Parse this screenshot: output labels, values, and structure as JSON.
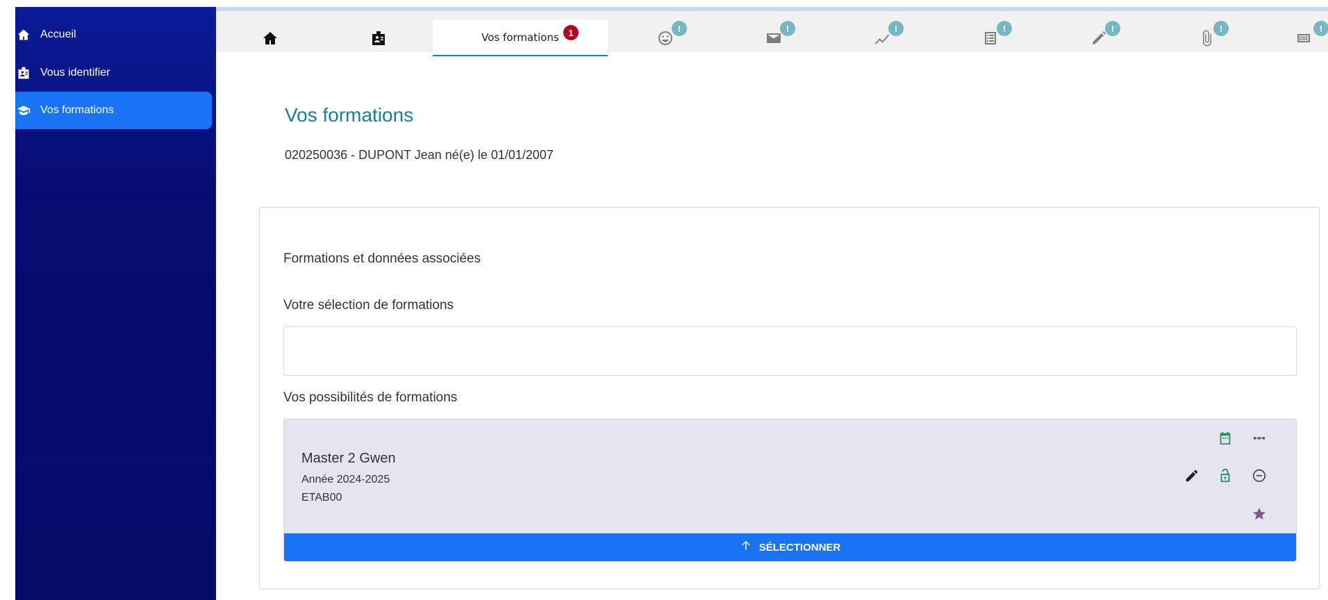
{
  "sidebar": {
    "items": [
      {
        "label": "Accueil",
        "icon": "home-icon"
      },
      {
        "label": "Vous identifier",
        "icon": "id-badge-icon"
      },
      {
        "label": "Vos formations",
        "icon": "graduation-cap-icon",
        "active": true
      }
    ]
  },
  "tabs": {
    "active_label": "Vos formations",
    "active_count": "1",
    "alert_mark": "!",
    "icons": [
      "home-icon",
      "id-badge-icon",
      "graduation-cap-icon",
      "face-icon",
      "envelope-icon",
      "chart-line-icon",
      "list-document-icon",
      "pen-icon",
      "paperclip-icon",
      "receipt-icon"
    ]
  },
  "main": {
    "title": "Vos formations",
    "student_info": "020250036 - DUPONT Jean né(e) le 01/01/2007"
  },
  "card": {
    "section_title": "Formations et données associées",
    "selection_label": "Votre sélection de formations",
    "possibilities_label": "Vos possibilités de formations",
    "formation": {
      "name": "Master 2 Gwen",
      "year": "Année 2024-2025",
      "etab": "ETAB00"
    },
    "select_button": "SÉLECTIONNER"
  },
  "colors": {
    "sidebar_bg": "#070a6e",
    "accent": "#1a73f5",
    "title": "#1d7c9a",
    "alert_badge": "#78b7c2",
    "count_badge": "#b0001e",
    "card_bg": "#e4e5f0",
    "green_icon": "#2e8b57",
    "star": "#7a5a8a"
  }
}
